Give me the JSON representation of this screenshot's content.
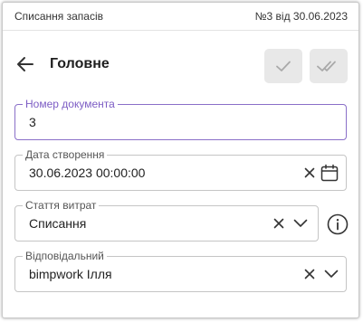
{
  "header": {
    "title": "Списання запасів",
    "doc_info": "№3 від 30.06.2023"
  },
  "section": {
    "title": "Головне"
  },
  "icons": {
    "back": "arrow-left-icon",
    "approve": "check-icon",
    "approve_all": "double-check-icon",
    "clear": "close-icon",
    "calendar": "calendar-icon",
    "dropdown": "chevron-down-icon",
    "info": "info-icon"
  },
  "colors": {
    "accent": "#7c5cc4",
    "button_bg": "#e8e8e8"
  },
  "fields": {
    "doc_number": {
      "label": "Номер документа",
      "value": "3"
    },
    "created_date": {
      "label": "Дата створення",
      "value": "30.06.2023 00:00:00"
    },
    "expense_item": {
      "label": "Стаття витрат",
      "value": "Списання"
    },
    "responsible": {
      "label": "Відповідальний",
      "value": "bimpwork Ілля"
    }
  }
}
